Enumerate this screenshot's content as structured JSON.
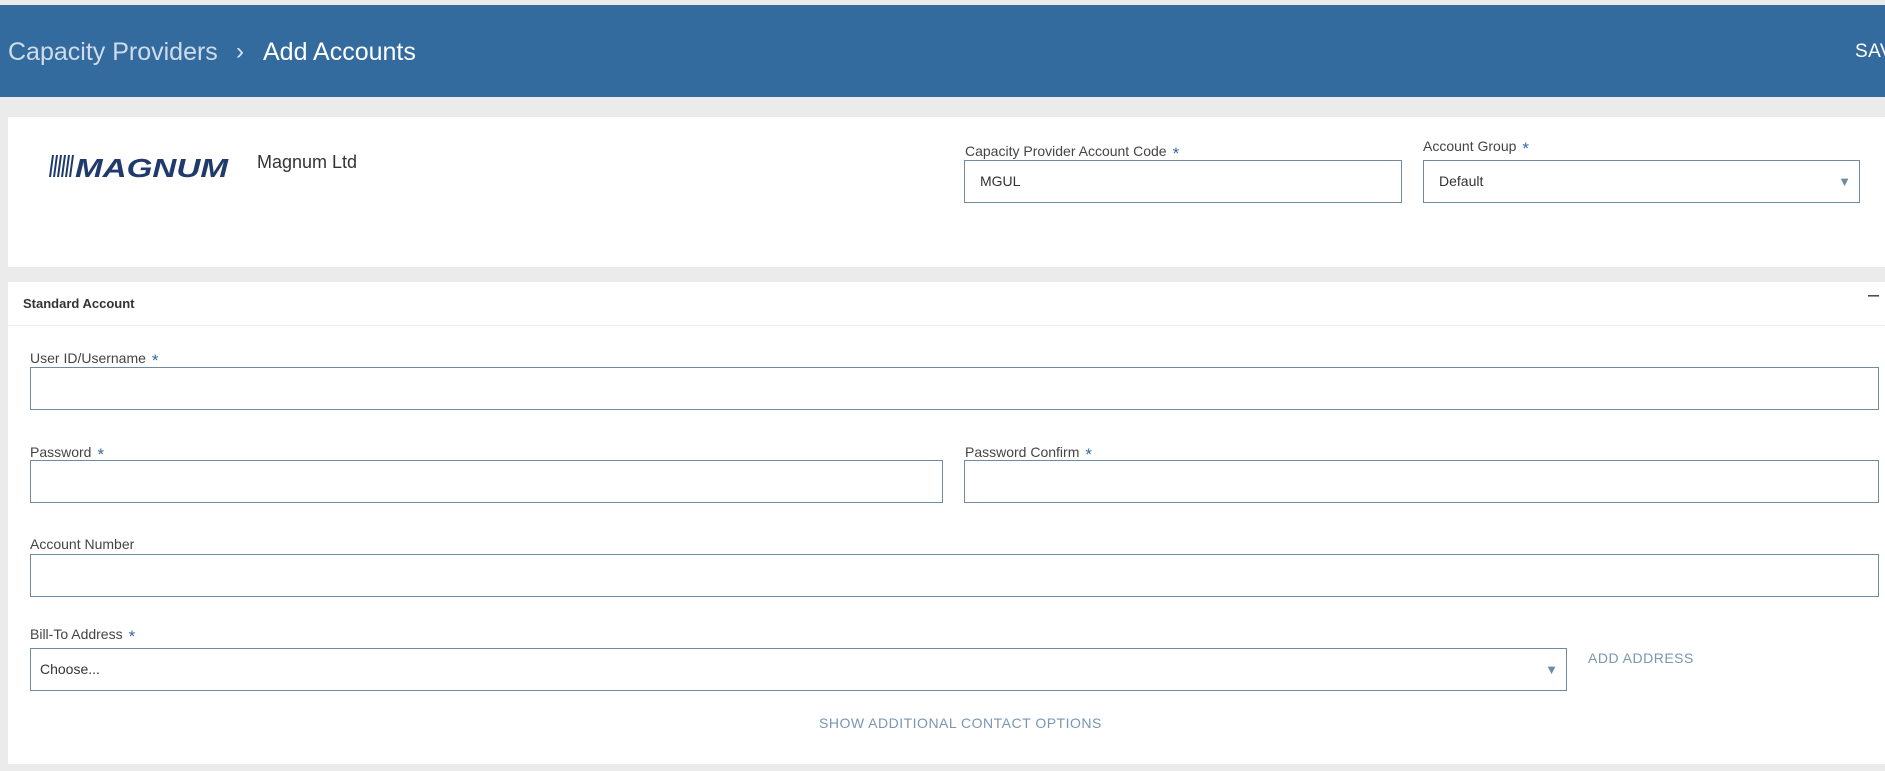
{
  "header": {
    "breadcrumb_root": "Capacity Providers",
    "breadcrumb_sep": "›",
    "breadcrumb_current": "Add Accounts",
    "save_label": "SAV"
  },
  "provider": {
    "logo_text": "MAGNUM",
    "name": "Magnum Ltd",
    "account_code_label": "Capacity Provider Account Code",
    "account_code_value": "MGUL",
    "account_group_label": "Account Group",
    "account_group_value": "Default"
  },
  "standard_account": {
    "title": "Standard Account",
    "collapse_symbol": "–",
    "username_label": "User ID/Username",
    "username_value": "",
    "password_label": "Password",
    "password_value": "",
    "password_confirm_label": "Password Confirm",
    "password_confirm_value": "",
    "account_number_label": "Account Number",
    "account_number_value": "",
    "bill_to_label": "Bill-To Address",
    "bill_to_value": "Choose...",
    "add_address_label": "ADD ADDRESS",
    "show_contact_options_label": "SHOW ADDITIONAL CONTACT OPTIONS"
  },
  "required_marker": "*",
  "dropdown_icon": "▼",
  "colors": {
    "header_bg": "#346b9f",
    "accent": "#346b9f",
    "link": "#7a96b0"
  }
}
